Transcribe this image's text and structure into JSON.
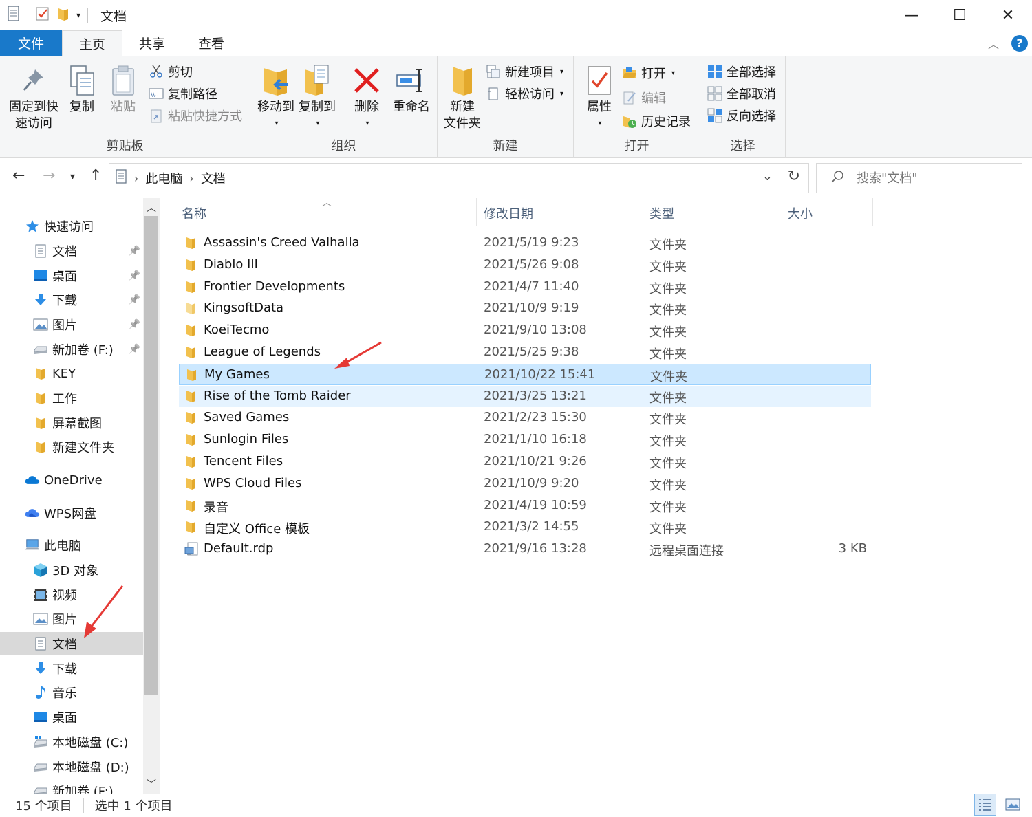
{
  "window": {
    "title": "文档",
    "controls": {
      "minimize": "—",
      "maximize": "☐",
      "close": "✕"
    }
  },
  "tabs": [
    {
      "label": "文件"
    },
    {
      "label": "主页"
    },
    {
      "label": "共享"
    },
    {
      "label": "查看"
    }
  ],
  "ribbon": {
    "clipboard": {
      "label": "剪贴板",
      "pin_line1": "固定到快",
      "pin_line2": "速访问",
      "copy": "复制",
      "paste": "粘贴",
      "cut": "剪切",
      "copy_path": "复制路径",
      "paste_shortcut": "粘贴快捷方式"
    },
    "organize": {
      "label": "组织",
      "move_to": "移动到",
      "copy_to": "复制到",
      "delete": "删除",
      "rename": "重命名"
    },
    "new": {
      "label": "新建",
      "new_folder_line1": "新建",
      "new_folder_line2": "文件夹",
      "new_item": "新建项目",
      "easy_access": "轻松访问"
    },
    "open": {
      "label": "打开",
      "properties": "属性",
      "open": "打开",
      "edit": "编辑",
      "history": "历史记录"
    },
    "select": {
      "label": "选择",
      "select_all": "全部选择",
      "select_none": "全部取消",
      "invert": "反向选择"
    }
  },
  "address": {
    "crumbs": [
      "此电脑",
      "文档"
    ],
    "search_placeholder": "搜索\"文档\""
  },
  "nav": {
    "items": [
      {
        "label": "快速访问",
        "icon": "star-icon",
        "level": 0
      },
      {
        "label": "文档",
        "icon": "document-icon",
        "level": 1,
        "pinned": true
      },
      {
        "label": "桌面",
        "icon": "desktop-icon",
        "level": 1,
        "pinned": true
      },
      {
        "label": "下载",
        "icon": "download-icon",
        "level": 1,
        "pinned": true
      },
      {
        "label": "图片",
        "icon": "pictures-icon",
        "level": 1,
        "pinned": true
      },
      {
        "label": "新加卷 (F:)",
        "icon": "drive-icon",
        "level": 1,
        "pinned": true
      },
      {
        "label": "KEY",
        "icon": "folder-icon",
        "level": 1
      },
      {
        "label": "工作",
        "icon": "folder-icon",
        "level": 1
      },
      {
        "label": "屏幕截图",
        "icon": "folder-icon",
        "level": 1
      },
      {
        "label": "新建文件夹",
        "icon": "folder-icon",
        "level": 1
      },
      {
        "label": "OneDrive",
        "icon": "cloud-icon",
        "level": 0
      },
      {
        "label": "WPS网盘",
        "icon": "wps-cloud-icon",
        "level": 0
      },
      {
        "label": "此电脑",
        "icon": "computer-icon",
        "level": 0
      },
      {
        "label": "3D 对象",
        "icon": "cube-icon",
        "level": 1
      },
      {
        "label": "视频",
        "icon": "video-icon",
        "level": 1
      },
      {
        "label": "图片",
        "icon": "pictures-icon",
        "level": 1
      },
      {
        "label": "文档",
        "icon": "document-icon",
        "level": 1,
        "selected": true
      },
      {
        "label": "下载",
        "icon": "download-icon",
        "level": 1
      },
      {
        "label": "音乐",
        "icon": "music-icon",
        "level": 1
      },
      {
        "label": "桌面",
        "icon": "desktop-icon",
        "level": 1
      },
      {
        "label": "本地磁盘 (C:)",
        "icon": "system-drive-icon",
        "level": 1
      },
      {
        "label": "本地磁盘 (D:)",
        "icon": "drive-icon",
        "level": 1
      },
      {
        "label": "新加卷 (F:)",
        "icon": "drive-icon",
        "level": 1
      }
    ]
  },
  "columns": {
    "name": "名称",
    "date": "修改日期",
    "type": "类型",
    "size": "大小"
  },
  "files": [
    {
      "name": "Assassin's Creed Valhalla",
      "date": "2021/5/19 9:23",
      "type": "文件夹",
      "size": ""
    },
    {
      "name": "Diablo III",
      "date": "2021/5/26 9:08",
      "type": "文件夹",
      "size": ""
    },
    {
      "name": "Frontier Developments",
      "date": "2021/4/7 11:40",
      "type": "文件夹",
      "size": ""
    },
    {
      "name": "KingsoftData",
      "date": "2021/10/9 9:19",
      "type": "文件夹",
      "size": ""
    },
    {
      "name": "KoeiTecmo",
      "date": "2021/9/10 13:08",
      "type": "文件夹",
      "size": ""
    },
    {
      "name": "League of Legends",
      "date": "2021/5/25 9:38",
      "type": "文件夹",
      "size": ""
    },
    {
      "name": "My Games",
      "date": "2021/10/22 15:41",
      "type": "文件夹",
      "size": "",
      "state": "selected"
    },
    {
      "name": "Rise of the Tomb Raider",
      "date": "2021/3/25 13:21",
      "type": "文件夹",
      "size": "",
      "state": "hover"
    },
    {
      "name": "Saved Games",
      "date": "2021/2/23 15:30",
      "type": "文件夹",
      "size": ""
    },
    {
      "name": "Sunlogin Files",
      "date": "2021/1/10 16:18",
      "type": "文件夹",
      "size": ""
    },
    {
      "name": "Tencent Files",
      "date": "2021/10/21 9:26",
      "type": "文件夹",
      "size": ""
    },
    {
      "name": "WPS Cloud Files",
      "date": "2021/10/9 9:20",
      "type": "文件夹",
      "size": ""
    },
    {
      "name": "录音",
      "date": "2021/4/19 10:59",
      "type": "文件夹",
      "size": ""
    },
    {
      "name": "自定义 Office 模板",
      "date": "2021/3/2 14:55",
      "type": "文件夹",
      "size": ""
    },
    {
      "name": "Default.rdp",
      "date": "2021/9/16 13:28",
      "type": "远程桌面连接",
      "size": "3 KB",
      "icon": "rdp-file-icon"
    }
  ],
  "status": {
    "count": "15 个项目",
    "selected": "选中 1 个项目"
  },
  "colors": {
    "accent": "#1979ca",
    "selection_bg": "#cce8ff",
    "hover_bg": "#e5f3ff",
    "folder": "#f2c14e",
    "annotation_arrow": "#e53935"
  }
}
